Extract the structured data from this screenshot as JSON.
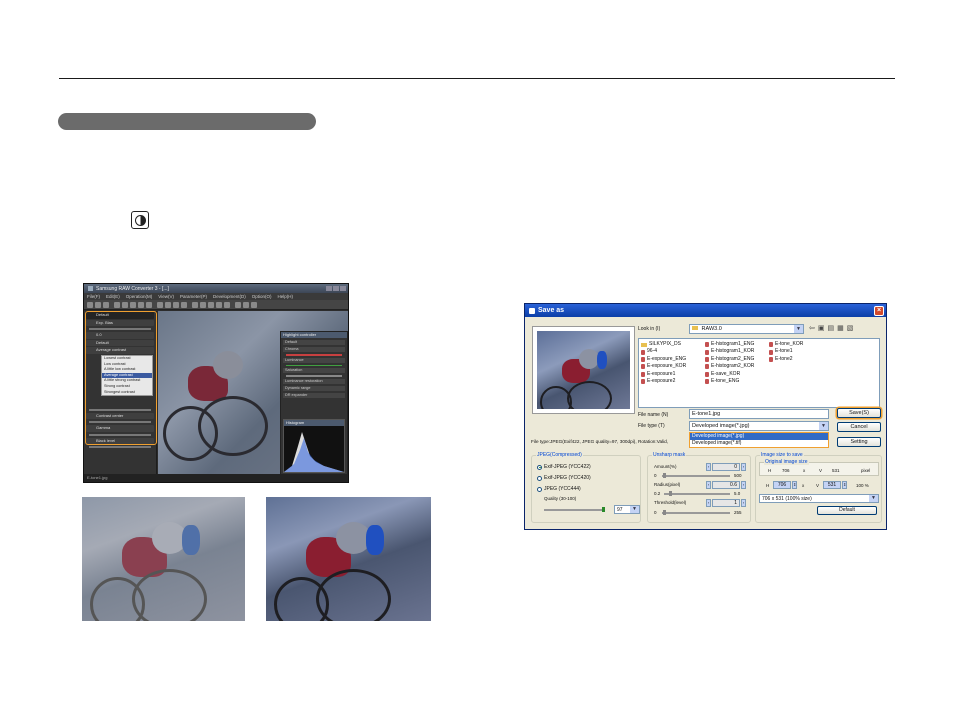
{
  "raw_converter": {
    "title": "Samsung RAW Converter 3 - [...]",
    "menu": [
      "File(F)",
      "Edit(E)",
      "Operation(M)",
      "View(V)",
      "Parameter(P)",
      "Development(D)",
      "Option(O)",
      "Help(H)"
    ],
    "left_panel": {
      "rows": [
        "Default",
        "Exp. Bias",
        "0.0",
        "Default",
        "Average contrast"
      ],
      "contrast_options": [
        "Lowest contrast",
        "Low contrast",
        "A little low contrast",
        "Average contrast",
        "A little strong contrast",
        "Strong contrast",
        "Strongest contrast"
      ],
      "selected_contrast": "Average contrast",
      "lower_rows": [
        "Contrast center",
        "Gamma",
        "Black level"
      ]
    },
    "right_panel": {
      "title": "Highlight controller",
      "rows": [
        "Default",
        "Chroma",
        "Luminance",
        "Saturation",
        "Luminance restoration",
        "Dynamic range",
        "DR expander"
      ],
      "histogram_title": "Histogram"
    },
    "status": "E-tone1.jpg"
  },
  "save_dialog": {
    "title": "Save as",
    "look_in_label": "Look in (I)",
    "look_in_value": "RAW3.0",
    "files_col1": [
      "SILKYPIX_DS",
      "96-4",
      "E-exposure_ENG",
      "E-exposure_KOR",
      "E-exposure1",
      "E-exposure2"
    ],
    "files_col2": [
      "E-histogram1_ENG",
      "E-histogram1_KOR",
      "E-histogram2_ENG",
      "E-histogram2_KOR",
      "E-save_KOR",
      "E-tone_ENG"
    ],
    "files_col3": [
      "E-tone_KOR",
      "E-tone1",
      "E-tone2"
    ],
    "file_name_label": "File name (N)",
    "file_name_value": "E-tone1.jpg",
    "file_type_label": "File type (T)",
    "file_type_value": "Developed image(*.jpg)",
    "file_type_options": [
      "Developed image(*.jpg)",
      "Developed image(*.tif)"
    ],
    "save_button": "Save(S)",
    "cancel_button": "Cancel",
    "setting_button": "Setting",
    "status": "File type:JPEG(Exif422, JPEG quality=97, 300dpi), Rotation:Valid,",
    "jpeg_group": {
      "title": "JPEG(Compressed)",
      "options": [
        "Exif-JPEG (YCC422)",
        "Exif-JPEG (YCC420)",
        "JPEG (YCC444)"
      ],
      "selected": "Exif-JPEG (YCC422)",
      "quality_label": "Quality (30-100)",
      "quality_value": "97"
    },
    "unsharp_group": {
      "title": "Unsharp mask",
      "amount_label": "Amount(%)",
      "amount_value": "0",
      "amount_min": "0",
      "amount_max": "500",
      "radius_label": "Radius(pixel)",
      "radius_value": "0.6",
      "radius_min": "0.2",
      "radius_max": "5.0",
      "threshold_label": "Threshold(level)",
      "threshold_value": "1",
      "threshold_min": "0",
      "threshold_max": "255"
    },
    "size_group": {
      "title": "Image size to save",
      "original_title": "Original image size",
      "h_label": "H",
      "h_value": "706",
      "x_label": "x",
      "v_label": "V",
      "v_value": "531",
      "unit": "pixel",
      "h2_value": "706",
      "v2_value": "531",
      "percent": "100 %",
      "preset": "706 x 531 (100% size)",
      "default_button": "Default"
    }
  }
}
